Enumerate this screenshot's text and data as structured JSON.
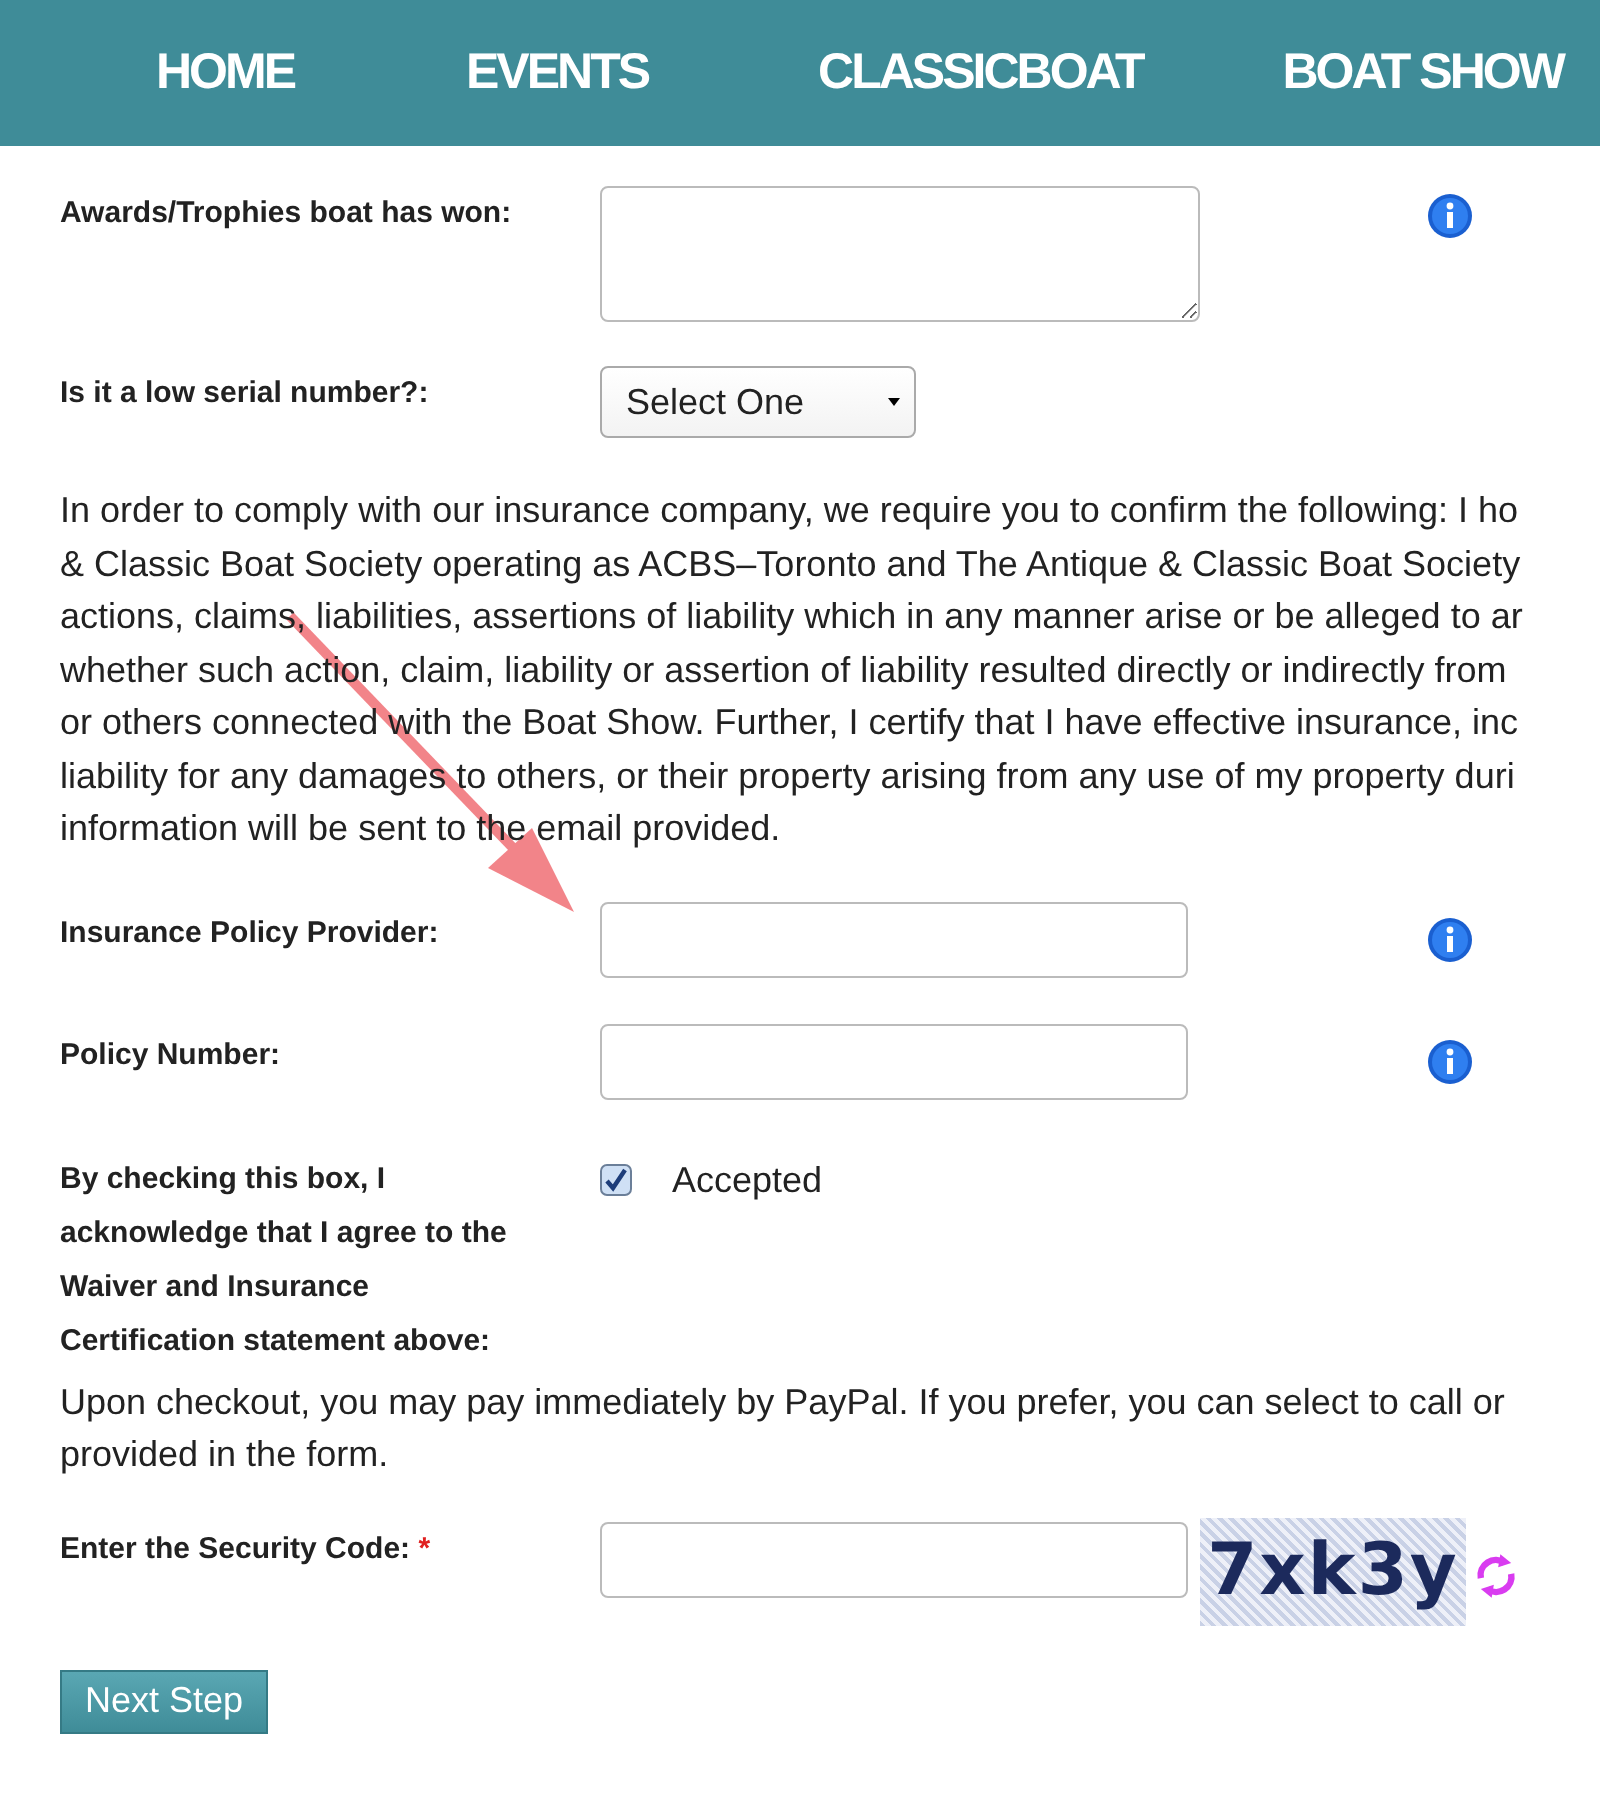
{
  "nav": [
    {
      "label": "HOME"
    },
    {
      "label": "EVENTS"
    },
    {
      "label": "CLASSICBOAT"
    },
    {
      "label": "BOAT SHOW"
    }
  ],
  "awards": {
    "label": "Awards/Trophies boat has won:",
    "info": true
  },
  "serial": {
    "label": "Is it a low serial number?:",
    "value": "Select One"
  },
  "waiver_lines": [
    "In order to comply with our insurance company, we require you to confirm the following: I ho",
    "& Classic Boat Society operating as ACBS–Toronto and The Antique & Classic Boat Society",
    "actions, claims, liabilities, assertions of liability which in any manner arise or be alleged to ar",
    "whether such action, claim, liability or assertion of liability resulted directly or indirectly from",
    "or others connected with the Boat Show. Further, I certify that I have effective insurance, inc",
    "liability for any damages to others, or their property arising from any use of my property duri",
    "information will be sent to the email provided."
  ],
  "provider": {
    "label": "Insurance Policy Provider:",
    "info": true
  },
  "policy": {
    "label": "Policy Number:",
    "info": true
  },
  "accept": {
    "label": "By checking this box, I acknowledge that I agree to the Waiver and Insurance Certification statement above:",
    "checked": true,
    "text": "Accepted"
  },
  "payment_lines": [
    "Upon checkout, you may pay immediately by PayPal. If you prefer, you can select to call or",
    "provided in the form."
  ],
  "security": {
    "label": "Enter the Security Code:",
    "required": "*",
    "captcha_code": "7xk3y"
  },
  "next_button": "Next Step"
}
